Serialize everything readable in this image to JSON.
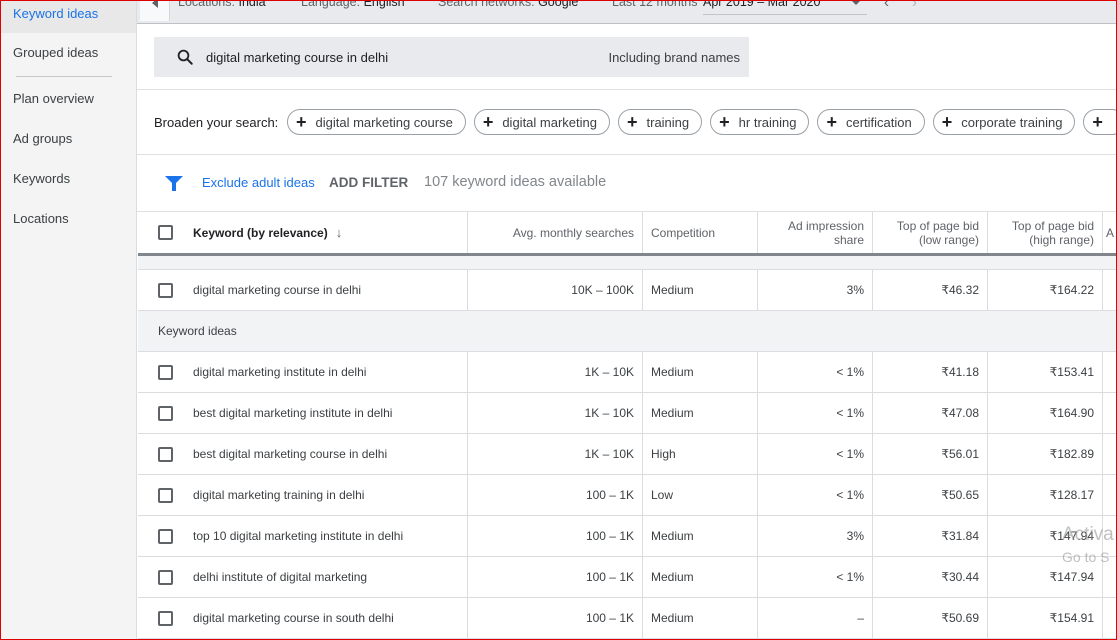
{
  "sidebar": {
    "items": [
      {
        "label": "Keyword ideas",
        "active": true
      },
      {
        "label": "Grouped ideas",
        "active": false
      }
    ],
    "plan_items": [
      {
        "label": "Plan overview"
      },
      {
        "label": "Ad groups"
      },
      {
        "label": "Keywords"
      },
      {
        "label": "Locations"
      }
    ]
  },
  "topbar": {
    "locations_label": "Locations:",
    "locations_value": "India",
    "language_label": "Language:",
    "language_value": "English",
    "networks_label": "Search networks:",
    "networks_value": "Google",
    "period_label": "Last 12 months",
    "date_range": "Apr 2019 – Mar 2020"
  },
  "search": {
    "query": "digital marketing course in delhi",
    "brand_toggle": "Including brand names"
  },
  "broaden": {
    "label": "Broaden your search:",
    "chips": [
      "digital marketing course",
      "digital marketing",
      "training",
      "hr training",
      "certification",
      "corporate training",
      ""
    ]
  },
  "filters": {
    "exclude_label": "Exclude adult ideas",
    "add_filter_label": "ADD FILTER",
    "count_text": "107 keyword ideas available"
  },
  "table": {
    "headers": {
      "keyword": "Keyword (by relevance)",
      "avg": "Avg. monthly searches",
      "competition": "Competition",
      "impression_1": "Ad impression",
      "impression_2": "share",
      "low_1": "Top of page bid",
      "low_2": "(low range)",
      "high_1": "Top of page bid",
      "high_2": "(high range)",
      "more": "A"
    },
    "searched_rows": [
      {
        "keyword": "digital marketing course in delhi",
        "avg": "10K – 100K",
        "competition": "Medium",
        "impression": "3%",
        "low": "₹46.32",
        "high": "₹164.22"
      }
    ],
    "section_label": "Keyword ideas",
    "rows": [
      {
        "keyword": "digital marketing institute in delhi",
        "avg": "1K – 10K",
        "competition": "Medium",
        "impression": "< 1%",
        "low": "₹41.18",
        "high": "₹153.41"
      },
      {
        "keyword": "best digital marketing institute in delhi",
        "avg": "1K – 10K",
        "competition": "Medium",
        "impression": "< 1%",
        "low": "₹47.08",
        "high": "₹164.90"
      },
      {
        "keyword": "best digital marketing course in delhi",
        "avg": "1K – 10K",
        "competition": "High",
        "impression": "< 1%",
        "low": "₹56.01",
        "high": "₹182.89"
      },
      {
        "keyword": "digital marketing training in delhi",
        "avg": "100 – 1K",
        "competition": "Low",
        "impression": "< 1%",
        "low": "₹50.65",
        "high": "₹128.17"
      },
      {
        "keyword": "top 10 digital marketing institute in delhi",
        "avg": "100 – 1K",
        "competition": "Medium",
        "impression": "3%",
        "low": "₹31.84",
        "high": "₹147.94"
      },
      {
        "keyword": "delhi institute of digital marketing",
        "avg": "100 – 1K",
        "competition": "Medium",
        "impression": "< 1%",
        "low": "₹30.44",
        "high": "₹147.94"
      },
      {
        "keyword": "digital marketing course in south delhi",
        "avg": "100 – 1K",
        "competition": "Medium",
        "impression": "–",
        "low": "₹50.69",
        "high": "₹154.91"
      }
    ]
  },
  "watermark": {
    "line1": "Activa",
    "line2": "Go to S"
  }
}
